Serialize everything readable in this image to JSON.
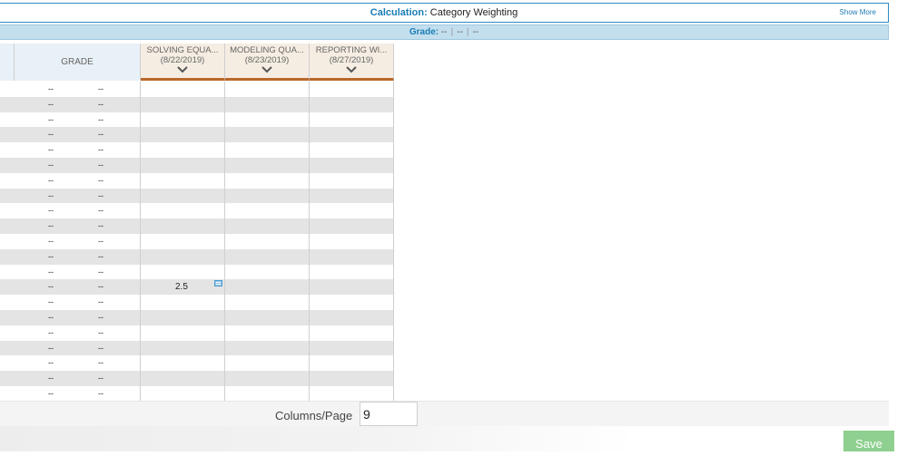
{
  "calculation": {
    "label": "Calculation:",
    "value": "Category Weighting",
    "show_more": "Show More"
  },
  "grade_bar": {
    "label": "Grade:",
    "values": [
      "--",
      "--",
      "--"
    ]
  },
  "table": {
    "grade_header": "GRADE",
    "assignments": [
      {
        "name": "SOLVING EQUATIONS",
        "name_display": "SOLVING EQUA...",
        "date": "(8/22/2019)"
      },
      {
        "name": "MODELING QUANTITIES",
        "name_display": "MODELING QUA...",
        "date": "(8/23/2019)"
      },
      {
        "name": "REPORTING WITH",
        "name_display": "REPORTING WI...",
        "date": "(8/27/2019)"
      }
    ],
    "row_count": 21,
    "grade_placeholder": "--",
    "score": {
      "row": 13,
      "value": "2.5"
    }
  },
  "footer": {
    "columns_label": "Columns/Page",
    "columns_value": "9"
  },
  "save_label": "Save",
  "colors": {
    "accent": "#1a7db6",
    "header_band": "#c3dfee",
    "assignment_header": "#f5ede2",
    "underline": "#b8682a",
    "save": "#8fcf8f"
  }
}
